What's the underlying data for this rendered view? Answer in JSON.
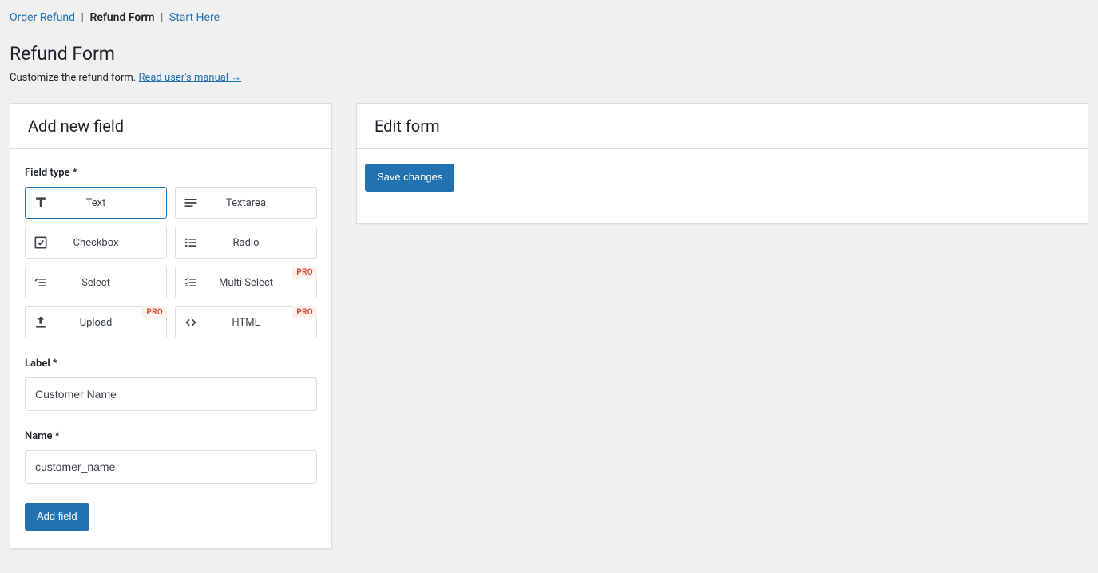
{
  "breadcrumb": {
    "items": [
      {
        "label": "Order Refund",
        "active": false
      },
      {
        "label": "Refund Form",
        "active": true
      },
      {
        "label": "Start Here",
        "active": false
      }
    ]
  },
  "page": {
    "title": "Refund Form",
    "description_prefix": "Customize the refund form. ",
    "manual_link": "Read user's manual →"
  },
  "left_panel": {
    "title": "Add new field",
    "field_type_label": "Field type *",
    "label_label": "Label *",
    "name_label": "Name *",
    "label_value": "Customer Name",
    "name_value": "customer_name",
    "add_button": "Add field",
    "types": [
      {
        "label": "Text",
        "pro": false,
        "selected": true
      },
      {
        "label": "Textarea",
        "pro": false,
        "selected": false
      },
      {
        "label": "Checkbox",
        "pro": false,
        "selected": false
      },
      {
        "label": "Radio",
        "pro": false,
        "selected": false
      },
      {
        "label": "Select",
        "pro": false,
        "selected": false
      },
      {
        "label": "Multi Select",
        "pro": true,
        "selected": false
      },
      {
        "label": "Upload",
        "pro": true,
        "selected": false
      },
      {
        "label": "HTML",
        "pro": true,
        "selected": false
      }
    ],
    "pro_badge": "PRO"
  },
  "right_panel": {
    "title": "Edit form",
    "save_button": "Save changes"
  }
}
